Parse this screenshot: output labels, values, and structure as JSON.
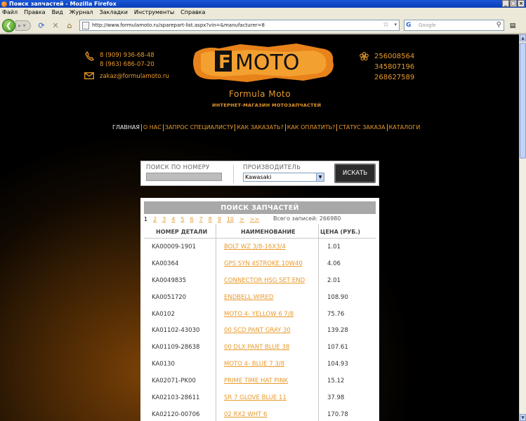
{
  "window": {
    "title": "Поиск запчастей - Mozilla Firefox",
    "menu": [
      "Файл",
      "Правка",
      "Вид",
      "Журнал",
      "Закладки",
      "Инструменты",
      "Справка"
    ]
  },
  "browser": {
    "url": "http://www.formulamoto.ru/sparepart-list.aspx?vin=&manufacturer=8",
    "search_placeholder": "Google"
  },
  "site": {
    "phones_left": [
      "8 (909) 936-68-48",
      "8 (963) 686-07-20"
    ],
    "email": "zakaz@formulamoto.ru",
    "icq": [
      "256008564",
      "345807196",
      "268627589"
    ],
    "logo_text": "MOTO",
    "logo_letter": "F",
    "brand_name": "Formula Moto",
    "brand_sub": "ИНТЕРНЕТ-МАГАЗИН МОТОЗАПЧАСТЕЙ",
    "nav": [
      "ГЛАВНАЯ",
      "О НАС",
      "ЗАПРОС СПЕЦИАЛИСТУ",
      "КАК ЗАКАЗАТЬ?",
      "КАК ОПЛАТИТЬ?",
      "СТАТУС ЗАКАЗА",
      "КАТАЛОГИ"
    ]
  },
  "search": {
    "by_number_label": "ПОИСК ПО НОМЕРУ",
    "manufacturer_label": "ПРОИЗВОДИТЕЛЬ",
    "manufacturer_value": "Kawasaki",
    "submit_label": "ИСКАТЬ"
  },
  "results": {
    "title": "ПОИСК ЗАПЧАСТЕЙ",
    "pages": [
      "1",
      "2",
      "3",
      "4",
      "5",
      "6",
      "7",
      "8",
      "9",
      "10",
      ">",
      ">>"
    ],
    "total": "Всего записей: 266980",
    "columns": [
      "НОМЕР ДЕТАЛИ",
      "НАИМЕНОВАНИЕ",
      "ЦЕНА (РУБ.)"
    ],
    "rows": [
      {
        "number": "KA00009-1901",
        "name": "BOLT WZ 3/8-16X3/4",
        "price": "1.01"
      },
      {
        "number": "KA00364",
        "name": "GPS SYN 4STROKE 10W40",
        "price": "4.06"
      },
      {
        "number": "KA0049835",
        "name": "CONNECTOR HSG SET END",
        "price": "2.01"
      },
      {
        "number": "KA0051720",
        "name": "ENDBELL WIRED",
        "price": "108.90"
      },
      {
        "number": "KA0102",
        "name": "MOTO 4- YELLOW 6 7/8",
        "price": "75.76"
      },
      {
        "number": "KA01102-43030",
        "name": "00 SCD PANT GRAY 30",
        "price": "139.28"
      },
      {
        "number": "KA01109-28638",
        "name": "00 DLX PANT BLUE 38",
        "price": "107.61"
      },
      {
        "number": "KA0130",
        "name": "MOTO 4- BLUE 7 3/8",
        "price": "104.93"
      },
      {
        "number": "KA02071-PK00",
        "name": "PRIME TIME HAT PINK",
        "price": "15.12"
      },
      {
        "number": "KA02103-28611",
        "name": "SR 7 GLOVE BLUE 11",
        "price": "37.98"
      },
      {
        "number": "KA02120-00706",
        "name": "02 RX2 WHT 6",
        "price": "170.78"
      }
    ]
  },
  "colors": {
    "accent": "#e89a2d",
    "titlebar": "#0a3fb8"
  }
}
